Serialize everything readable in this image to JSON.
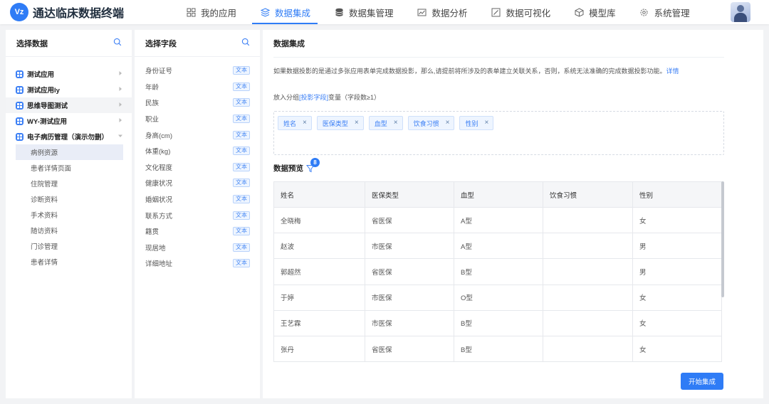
{
  "app": {
    "logo_text": "Vz",
    "title": "通达临床数据终端"
  },
  "nav": [
    {
      "label": "我的应用",
      "icon": "grid-icon",
      "active": false
    },
    {
      "label": "数据集成",
      "icon": "layers-icon",
      "active": true
    },
    {
      "label": "数据集管理",
      "icon": "database-icon",
      "active": false
    },
    {
      "label": "数据分析",
      "icon": "chart-image-icon",
      "active": false
    },
    {
      "label": "数据可视化",
      "icon": "pen-icon",
      "active": false
    },
    {
      "label": "模型库",
      "icon": "cube-icon",
      "active": false
    },
    {
      "label": "系统管理",
      "icon": "gear-icon",
      "active": false
    }
  ],
  "left": {
    "title": "选择数据",
    "apps": [
      {
        "label": "测试应用"
      },
      {
        "label": "测试应用ly"
      },
      {
        "label": "思维导图测试"
      },
      {
        "label": "WY-测试应用"
      },
      {
        "label": "电子病历管理（演示勿删）"
      }
    ],
    "subs": [
      "病例资源",
      "患者详情页面",
      "住院管理",
      "诊断资料",
      "手术资料",
      "随访资料",
      "门诊管理",
      "患者详情"
    ]
  },
  "middle": {
    "title": "选择字段",
    "tag": "文本",
    "fields": [
      "身份证号",
      "年龄",
      "民族",
      "职业",
      "身高(cm)",
      "体重(kg)",
      "文化程度",
      "健康状况",
      "婚姻状况",
      "联系方式",
      "籍贯",
      "现居地",
      "详细地址"
    ]
  },
  "main": {
    "title": "数据集成",
    "desc": "如果数据投影的是通过多张应用表单完成数据投影，那么,请提前将所涉及的表单建立关联关系，否则，系统无法准确的完成数据投影功能。",
    "desc_link": "详情",
    "putin_prefix": "放入分组",
    "putin_link": "[投影字段]",
    "putin_suffix": "变量（字段数≥1）",
    "chips": [
      "姓名",
      "医保类型",
      "血型",
      "饮食习惯",
      "性别"
    ],
    "preview_title": "数据预览",
    "filter_count": "8",
    "columns": [
      "姓名",
      "医保类型",
      "血型",
      "饮食习惯",
      "性别"
    ],
    "rows": [
      [
        "全晓梅",
        "省医保",
        "A型",
        "",
        "女"
      ],
      [
        "赵波",
        "市医保",
        "A型",
        "",
        "男"
      ],
      [
        "郭超然",
        "省医保",
        "B型",
        "",
        "男"
      ],
      [
        "于婷",
        "市医保",
        "O型",
        "",
        "女"
      ],
      [
        "王艺霖",
        "市医保",
        "B型",
        "",
        "女"
      ],
      [
        "张丹",
        "省医保",
        "B型",
        "",
        "女"
      ]
    ],
    "start_button": "开始集成"
  }
}
